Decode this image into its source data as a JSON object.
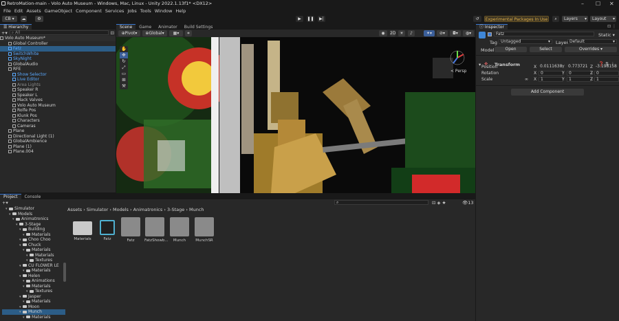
{
  "window": {
    "title": "RetroMation-main - Volo Auto Museum - Windows, Mac, Linux - Unity 2022.1.13f1* <DX12>"
  },
  "menu": [
    "File",
    "Edit",
    "Assets",
    "GameObject",
    "Component",
    "Services",
    "Jobs",
    "Tools",
    "Window",
    "Help"
  ],
  "toolbar": {
    "account": "CB",
    "experimental": "Experimental Packages In Use",
    "layers": "Layers",
    "layout": "Layout"
  },
  "hierarchy": {
    "tab": "Hierarchy",
    "search": "All",
    "items": [
      {
        "label": "Volo Auto Museum*",
        "indent": 0,
        "style": "scene"
      },
      {
        "label": "Global Controller",
        "indent": 2,
        "style": ""
      },
      {
        "label": "Fatz",
        "indent": 2,
        "style": "blue sel"
      },
      {
        "label": "SwitchWhite",
        "indent": 2,
        "style": "blue"
      },
      {
        "label": "SkyNight",
        "indent": 2,
        "style": "blue"
      },
      {
        "label": "GlobalAudio",
        "indent": 2,
        "style": ""
      },
      {
        "label": "RFE",
        "indent": 2,
        "style": ""
      },
      {
        "label": "Show Selector",
        "indent": 3,
        "style": "blue"
      },
      {
        "label": "Live Editor",
        "indent": 3,
        "style": "blue"
      },
      {
        "label": "Area Lights",
        "indent": 3,
        "style": "dim"
      },
      {
        "label": "Speaker R",
        "indent": 3,
        "style": ""
      },
      {
        "label": "Speaker L",
        "indent": 3,
        "style": ""
      },
      {
        "label": "Mack Valves",
        "indent": 3,
        "style": ""
      },
      {
        "label": "Volo Auto Museum",
        "indent": 3,
        "style": ""
      },
      {
        "label": "Rolfe Pos",
        "indent": 3,
        "style": ""
      },
      {
        "label": "Klunk Pos",
        "indent": 3,
        "style": ""
      },
      {
        "label": "Characters",
        "indent": 3,
        "style": ""
      },
      {
        "label": "Cameras",
        "indent": 3,
        "style": ""
      },
      {
        "label": "Plane",
        "indent": 2,
        "style": ""
      },
      {
        "label": "Directional Light (1)",
        "indent": 2,
        "style": ""
      },
      {
        "label": "GlobalAmbience",
        "indent": 2,
        "style": ""
      },
      {
        "label": "Plane (1)",
        "indent": 2,
        "style": ""
      },
      {
        "label": "Plane.004",
        "indent": 2,
        "style": ""
      }
    ]
  },
  "scene": {
    "tabs": [
      "Scene",
      "Game",
      "Animator",
      "Build Settings"
    ],
    "pivot": "Pivot",
    "global": "Global",
    "persp": "< Persp"
  },
  "inspector": {
    "tab": "Inspector",
    "name": "Fatz",
    "static": "Static",
    "tag_label": "Tag",
    "tag": "Untagged",
    "layer_label": "Layer",
    "layer": "Default",
    "model_label": "Model",
    "open": "Open",
    "select": "Select",
    "overrides": "Overrides",
    "transform": "Transform",
    "position_label": "Position",
    "px": "0.0111638",
    "py": "0.773721",
    "pz": "-3.198158",
    "rotation_label": "Rotation",
    "rx": "0",
    "ry": "0",
    "rz": "0",
    "scale_label": "Scale",
    "sx": "1",
    "sy": "1",
    "sz": "1",
    "add_component": "Add Component"
  },
  "project": {
    "tabs": [
      "Project",
      "Console"
    ],
    "breadcrumb": [
      "Assets",
      "Simulator",
      "Models",
      "Animatronics",
      "3-Stage",
      "Munch"
    ],
    "count": "13",
    "tree": [
      {
        "label": "Simulator",
        "indent": 1
      },
      {
        "label": "Models",
        "indent": 2
      },
      {
        "label": "Animatronics",
        "indent": 3
      },
      {
        "label": "3-Stage",
        "indent": 4
      },
      {
        "label": "Building",
        "indent": 5
      },
      {
        "label": "Materials",
        "indent": 6
      },
      {
        "label": "Choo Choo",
        "indent": 5
      },
      {
        "label": "Chuck",
        "indent": 5
      },
      {
        "label": "Materials",
        "indent": 6
      },
      {
        "label": "Materials",
        "indent": 7
      },
      {
        "label": "Textures",
        "indent": 7
      },
      {
        "label": "CU FLOWER LE",
        "indent": 5
      },
      {
        "label": "Materials",
        "indent": 6
      },
      {
        "label": "Helen",
        "indent": 5
      },
      {
        "label": "Animations",
        "indent": 6
      },
      {
        "label": "Materials",
        "indent": 6
      },
      {
        "label": "Textures",
        "indent": 7
      },
      {
        "label": "Jasper",
        "indent": 5
      },
      {
        "label": "Materials",
        "indent": 6
      },
      {
        "label": "Moon",
        "indent": 5
      },
      {
        "label": "Munch",
        "indent": 5,
        "sel": true
      },
      {
        "label": "Materials",
        "indent": 6
      }
    ],
    "assets": [
      "Materials",
      "Fatz",
      "Fatz",
      "FatzShowb...",
      "Munch",
      "MunchSR"
    ]
  }
}
